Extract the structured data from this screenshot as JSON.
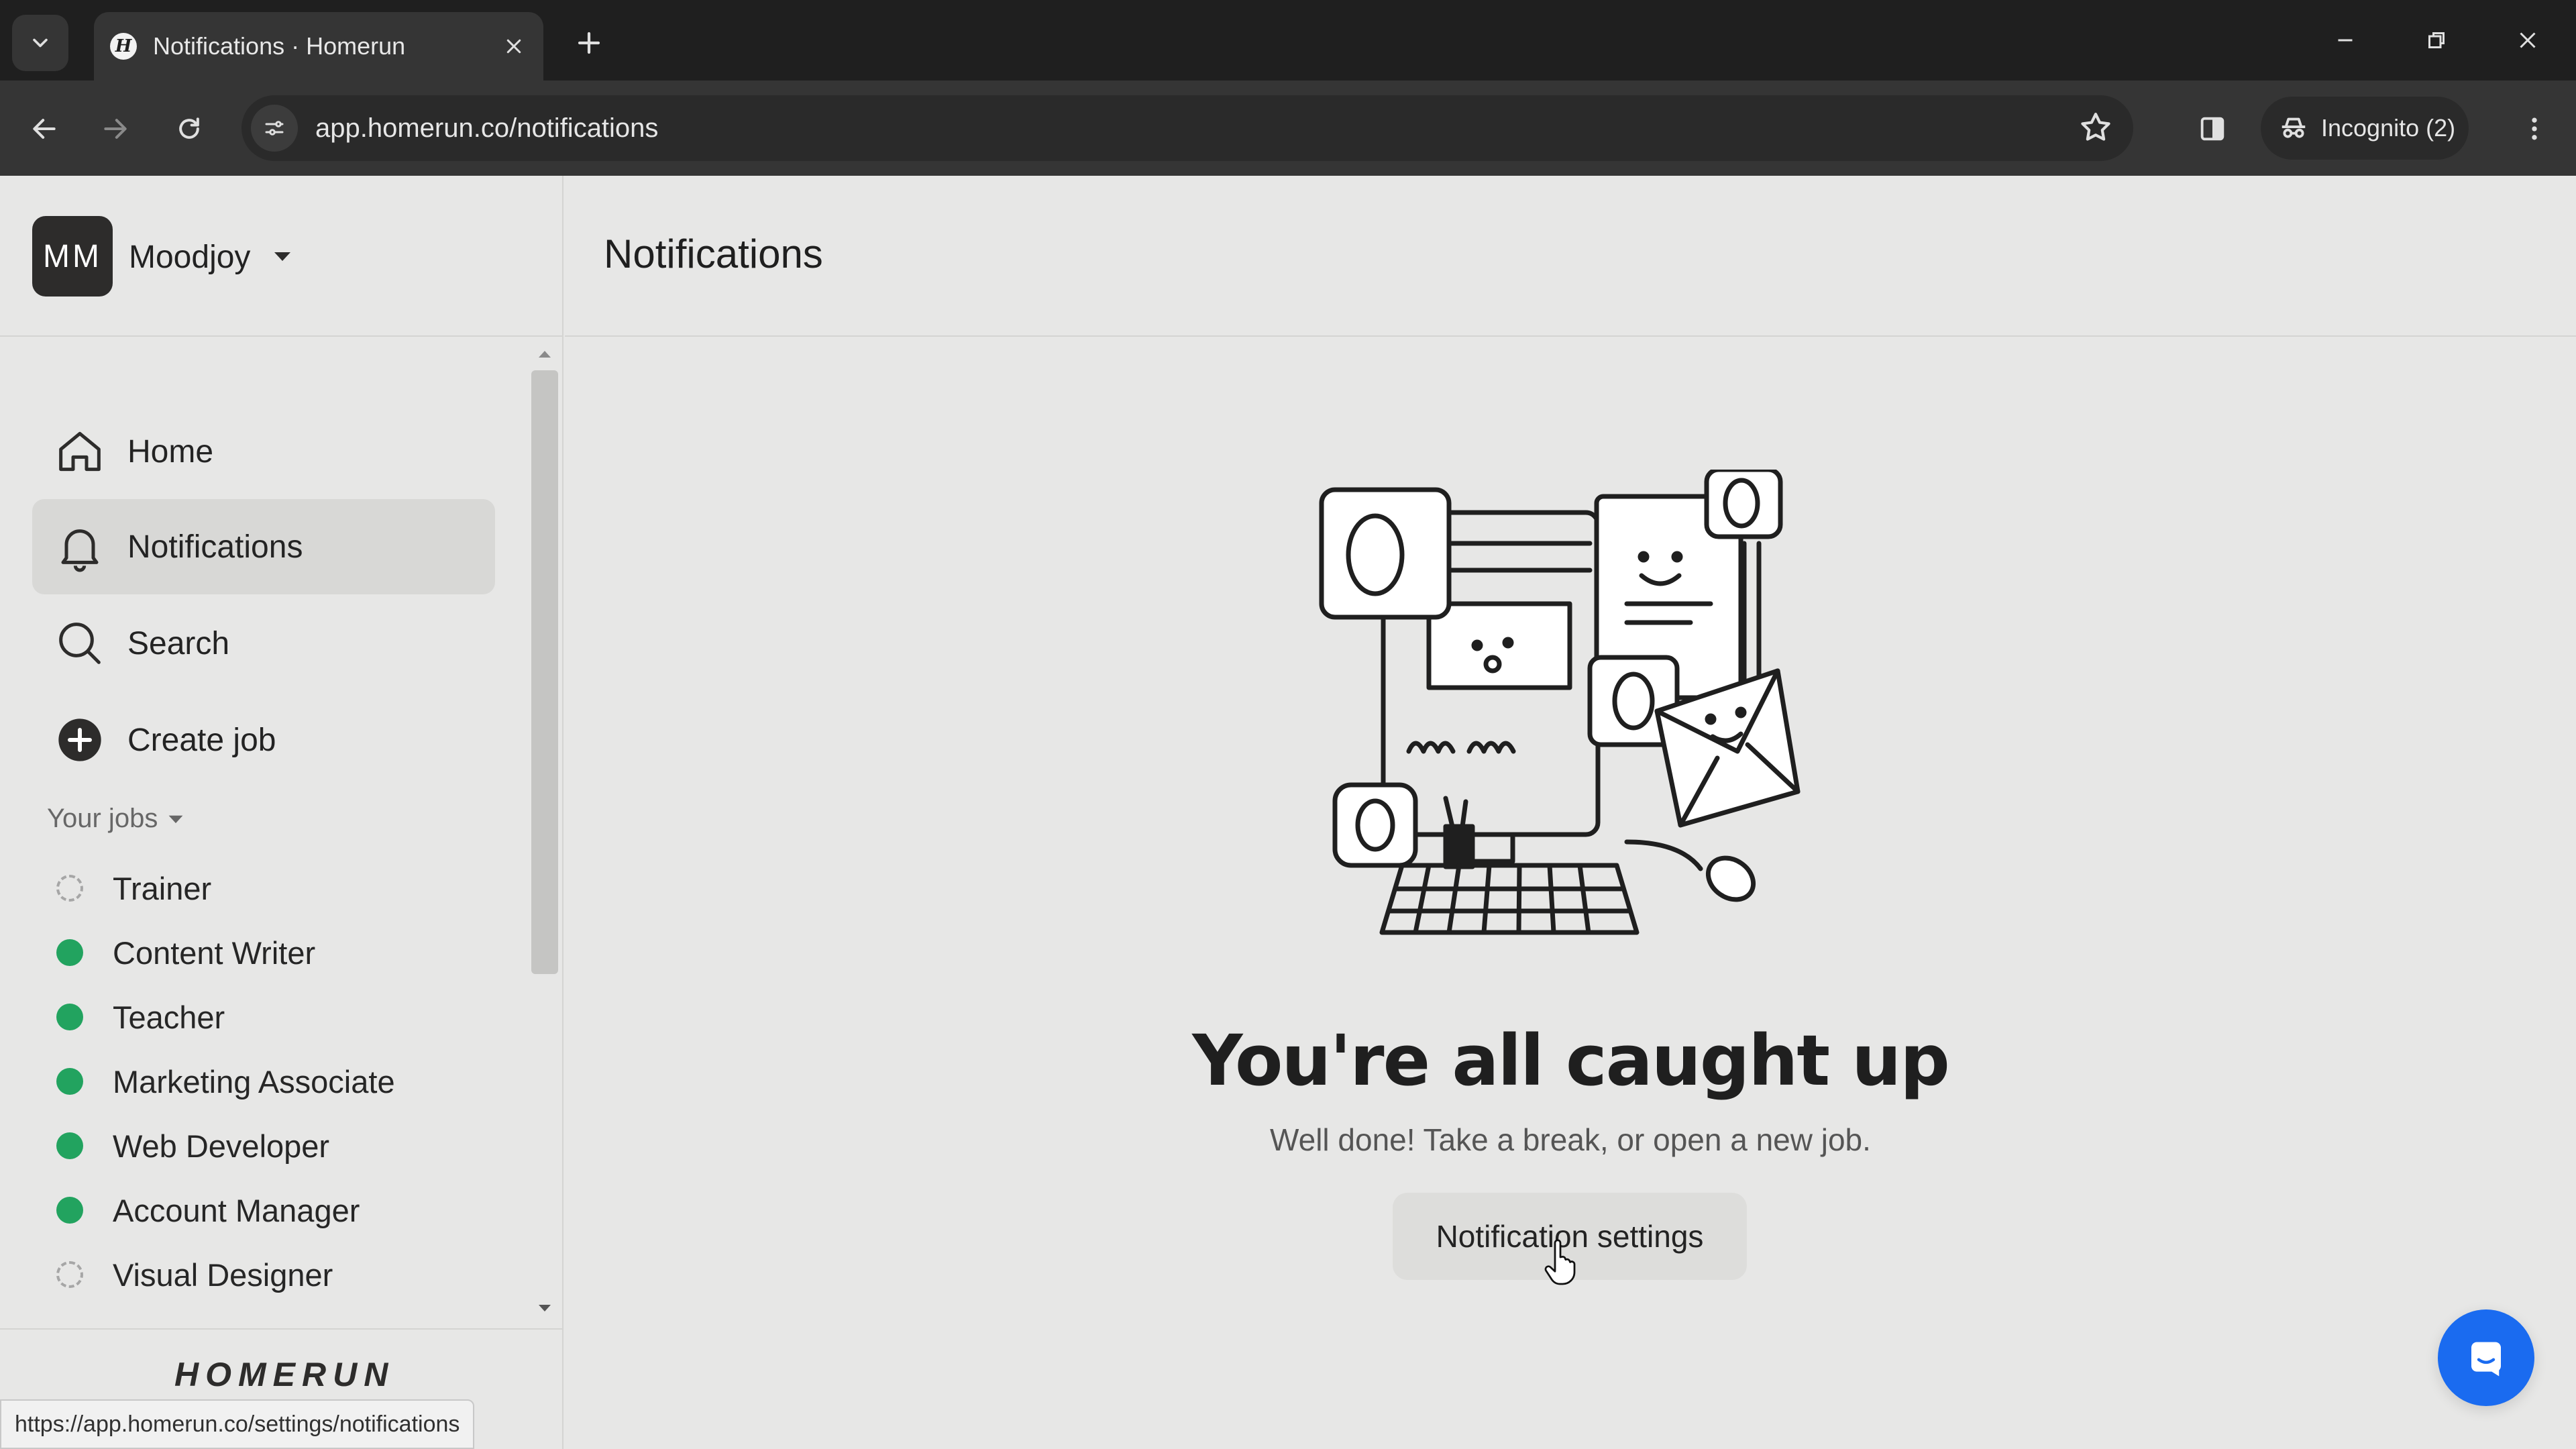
{
  "browser": {
    "tab_title": "Notifications · Homerun",
    "favicon_letter": "H",
    "url": "app.homerun.co/notifications",
    "incognito_label": "Incognito (2)",
    "status_bar_url": "https://app.homerun.co/settings/notifications"
  },
  "workspace": {
    "initials": "MM",
    "name": "Moodjoy"
  },
  "nav": {
    "home": "Home",
    "notifications": "Notifications",
    "search": "Search",
    "create_job": "Create job"
  },
  "jobs": {
    "header": "Your jobs",
    "items": [
      {
        "label": "Trainer",
        "status": "draft"
      },
      {
        "label": "Content Writer",
        "status": "open"
      },
      {
        "label": "Teacher",
        "status": "open"
      },
      {
        "label": "Marketing Associate",
        "status": "open"
      },
      {
        "label": "Web Developer",
        "status": "open"
      },
      {
        "label": "Account Manager",
        "status": "open"
      },
      {
        "label": "Visual Designer",
        "status": "draft"
      }
    ]
  },
  "brand": "HOMERUN",
  "main": {
    "page_title": "Notifications",
    "empty_title": "You're all caught up",
    "empty_subtitle": "Well done! Take a break, or open a new job.",
    "settings_button": "Notification settings"
  },
  "colors": {
    "open_status": "#22a35f",
    "chat_launcher": "#1a6bf0",
    "browser_frame": "#1f1f1f",
    "page_background": "#e7e7e6"
  }
}
